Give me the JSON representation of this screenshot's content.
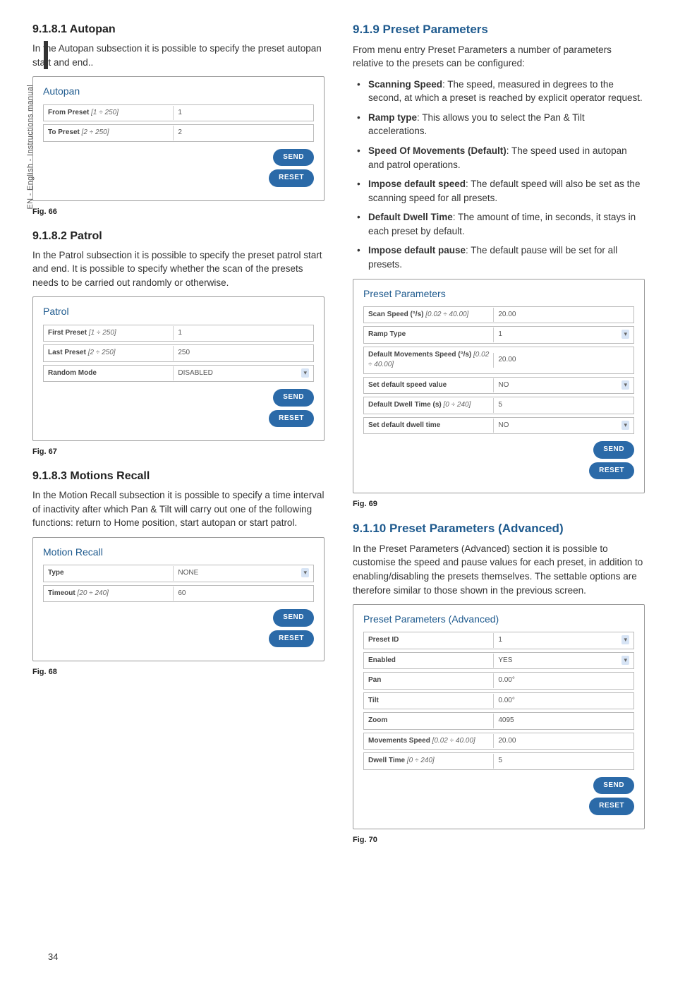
{
  "page": {
    "number": "34",
    "side_label": "EN - English - Instructions manual"
  },
  "left": {
    "s1": {
      "heading": "9.1.8.1 Autopan",
      "intro": "In the Autopan subsection it is possible to specify the preset autopan start and end..",
      "fig": {
        "title": "Autopan",
        "rows": [
          {
            "label": "From Preset",
            "range": "[1 ÷ 250]",
            "value": "1"
          },
          {
            "label": "To Preset",
            "range": "[2 ÷ 250]",
            "value": "2"
          }
        ],
        "send": "SEND",
        "reset": "RESET",
        "caption": "Fig. 66"
      }
    },
    "s2": {
      "heading": "9.1.8.2 Patrol",
      "intro": "In the Patrol subsection it is possible to specify the preset patrol start and end. It is possible to specify whether the scan of the presets needs to be carried out randomly or otherwise.",
      "fig": {
        "title": "Patrol",
        "rows": [
          {
            "label": "First Preset",
            "range": "[1 ÷ 250]",
            "value": "1"
          },
          {
            "label": "Last Preset",
            "range": "[2 ÷ 250]",
            "value": "250"
          },
          {
            "label": "Random Mode",
            "range": "",
            "value": "DISABLED",
            "select": true
          }
        ],
        "send": "SEND",
        "reset": "RESET",
        "caption": "Fig. 67"
      }
    },
    "s3": {
      "heading": "9.1.8.3 Motions Recall",
      "intro": "In the Motion Recall subsection it is possible to specify a time interval of inactivity after which Pan & Tilt will carry out one of the following functions: return to Home position, start autopan or start patrol.",
      "fig": {
        "title": "Motion Recall",
        "rows": [
          {
            "label": "Type",
            "range": "",
            "value": "NONE",
            "select": true
          },
          {
            "label": "Timeout",
            "range": "[20 ÷ 240]",
            "value": "60"
          }
        ],
        "send": "SEND",
        "reset": "RESET",
        "caption": "Fig. 68"
      }
    }
  },
  "right": {
    "s4": {
      "heading": "9.1.9 Preset Parameters",
      "intro": "From menu entry Preset Parameters a number of parameters relative to the presets can be configured:",
      "items": [
        {
          "term": "Scanning Speed",
          "desc": ": The speed, measured in degrees to the second, at which a preset is reached by explicit operator request."
        },
        {
          "term": "Ramp type",
          "desc": ": This allows you to select the Pan & Tilt accelerations."
        },
        {
          "term": "Speed Of Movements (Default)",
          "desc": ": The speed used in autopan and patrol operations."
        },
        {
          "term": "Impose default speed",
          "desc": ": The default speed will also be set as the scanning speed for all presets."
        },
        {
          "term": "Default Dwell Time",
          "desc": ": The amount of time, in seconds, it stays in each preset by default."
        },
        {
          "term": "Impose default pause",
          "desc": ": The default pause will be set for all presets."
        }
      ],
      "fig": {
        "title": "Preset Parameters",
        "rows": [
          {
            "label": "Scan Speed (°/s)",
            "range": "[0.02 ÷ 40.00]",
            "value": "20.00"
          },
          {
            "label": "Ramp Type",
            "range": "",
            "value": "1",
            "select": true
          },
          {
            "label": "Default Movements Speed (°/s)",
            "range": "[0.02 ÷ 40.00]",
            "value": "20.00"
          },
          {
            "label": "Set default speed value",
            "range": "",
            "value": "NO",
            "select": true
          },
          {
            "label": "Default Dwell Time (s)",
            "range": "[0 ÷ 240]",
            "value": "5"
          },
          {
            "label": "Set default dwell time",
            "range": "",
            "value": "NO",
            "select": true
          }
        ],
        "send": "SEND",
        "reset": "RESET",
        "caption": "Fig. 69"
      }
    },
    "s5": {
      "heading": "9.1.10 Preset Parameters (Advanced)",
      "intro": "In the Preset Parameters (Advanced) section it is possible to customise the speed and pause values for each preset, in addition to enabling/disabling the presets themselves. The settable options are therefore similar to those shown in the previous screen.",
      "fig": {
        "title": "Preset Parameters (Advanced)",
        "rows": [
          {
            "label": "Preset ID",
            "range": "",
            "value": "1",
            "select": true
          },
          {
            "label": "Enabled",
            "range": "",
            "value": "YES",
            "select": true
          },
          {
            "label": "Pan",
            "range": "",
            "value": "0.00°"
          },
          {
            "label": "Tilt",
            "range": "",
            "value": "0.00°"
          },
          {
            "label": "Zoom",
            "range": "",
            "value": "4095"
          },
          {
            "label": "Movements Speed",
            "range": "[0.02 ÷ 40.00]",
            "value": "20.00"
          },
          {
            "label": "Dwell Time",
            "range": "[0 ÷ 240]",
            "value": "5"
          }
        ],
        "send": "SEND",
        "reset": "RESET",
        "caption": "Fig. 70"
      }
    }
  }
}
